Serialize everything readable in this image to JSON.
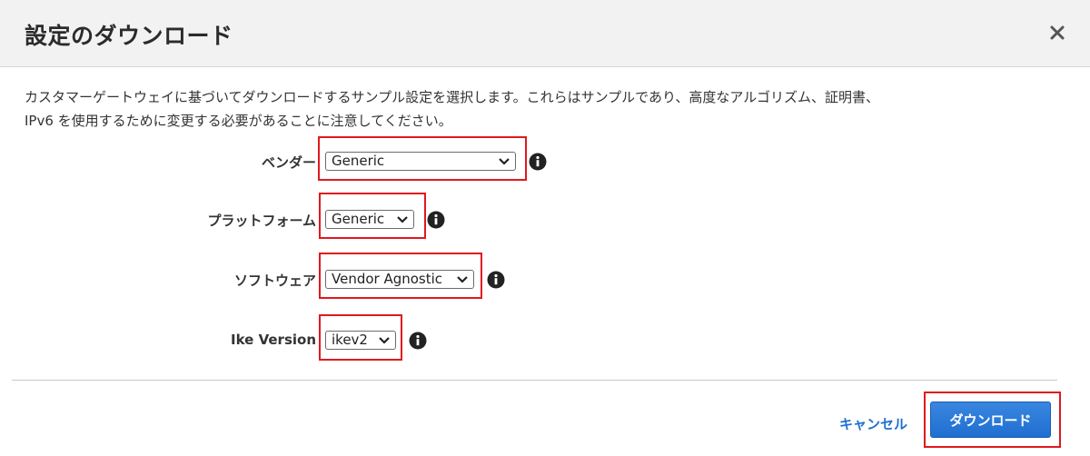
{
  "dialog": {
    "title": "設定のダウンロード",
    "description_line1": "カスタマーゲートウェイに基づいてダウンロードするサンプル設定を選択します。これらはサンプルであり、高度なアルゴリズム、証明書、",
    "description_line2": "IPv6 を使用するために変更する必要があることに注意してください。"
  },
  "form": {
    "vendor": {
      "label": "ベンダー",
      "value": "Generic"
    },
    "platform": {
      "label": "プラットフォーム",
      "value": "Generic"
    },
    "software": {
      "label": "ソフトウェア",
      "value": "Vendor Agnostic"
    },
    "ike_version": {
      "label": "Ike Version",
      "value": "ikev2"
    }
  },
  "footer": {
    "cancel_label": "キャンセル",
    "download_label": "ダウンロード"
  },
  "icons": {
    "close": "close-icon",
    "info": "info-icon",
    "dropdown": "chevron-down-icon"
  },
  "colors": {
    "primary": "#1f6fd1",
    "highlight": "#e0191d",
    "header_bg": "#f2f2f2"
  }
}
